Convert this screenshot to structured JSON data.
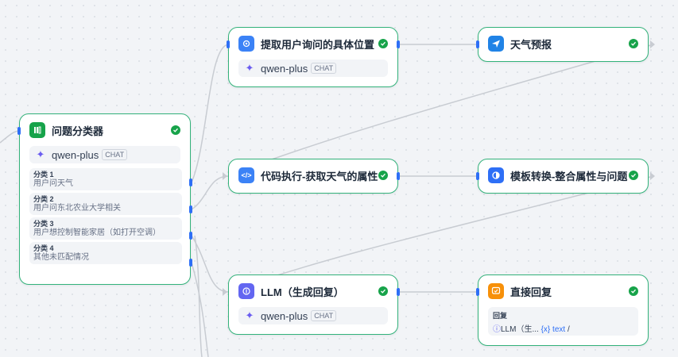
{
  "nodes": {
    "classifier": {
      "title": "问题分类器",
      "model": "qwen-plus",
      "model_tag": "CHAT",
      "classes": [
        {
          "title": "分类 1",
          "desc": "用户问天气"
        },
        {
          "title": "分类 2",
          "desc": "用户问东北农业大学相关"
        },
        {
          "title": "分类 3",
          "desc": "用户想控制智能家居（如打开空调）"
        },
        {
          "title": "分类 4",
          "desc": "其他未匹配情况"
        }
      ]
    },
    "extract": {
      "title": "提取用户询问的具体位置",
      "model": "qwen-plus",
      "model_tag": "CHAT"
    },
    "weather": {
      "title": "天气预报"
    },
    "code": {
      "title": "代码执行-获取天气的属性"
    },
    "template": {
      "title": "模板转换-整合属性与问题"
    },
    "llm": {
      "title": "LLM（生成回复）",
      "model": "qwen-plus",
      "model_tag": "CHAT"
    },
    "answer": {
      "title": "直接回复",
      "reply_label": "回复",
      "reply_node": "LLM（生...",
      "reply_var": "{x} text",
      "reply_sep": "/"
    }
  },
  "colors": {
    "success_border": "#33b27b",
    "handle": "#2e6ff6",
    "classifier_icon": "#16a34a",
    "extract_icon": "#3b82f6",
    "weather_icon": "#2083e6",
    "code_icon": "#3b82f6",
    "template_icon": "#2e6ff6",
    "llm_icon": "#6366f1",
    "answer_icon": "#f79009"
  },
  "icons": {
    "classifier": "question-classifier-icon",
    "extract": "parameter-extractor-icon",
    "weather": "weather-tool-icon",
    "code": "code-icon",
    "template": "template-transform-icon",
    "llm": "llm-icon",
    "answer": "direct-reply-icon",
    "status": "success-check-icon",
    "model": "qwen-model-icon"
  }
}
